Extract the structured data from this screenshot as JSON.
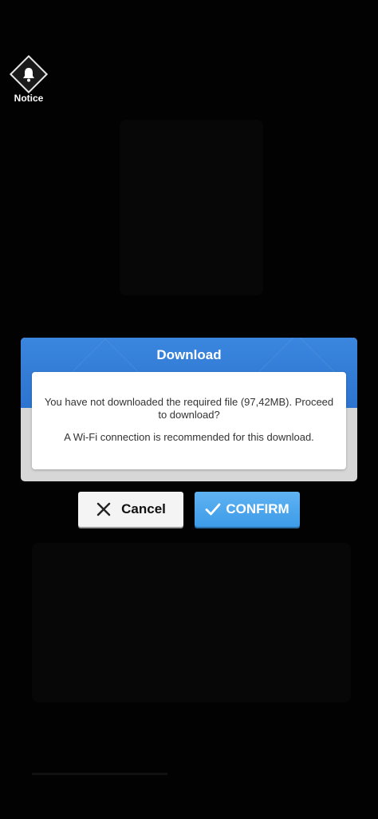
{
  "notice": {
    "label": "Notice",
    "icon": "bell-icon"
  },
  "dialog": {
    "title": "Download",
    "message": "You have not downloaded the required file (97,42MB). Proceed to download?",
    "note": "A Wi-Fi connection is recommended for this download.",
    "header_color": "#3a86de"
  },
  "buttons": {
    "cancel_label": "Cancel",
    "cancel_icon": "close-icon",
    "confirm_label": "CONFIRM",
    "confirm_icon": "check-icon",
    "confirm_color": "#4aa6ee"
  }
}
